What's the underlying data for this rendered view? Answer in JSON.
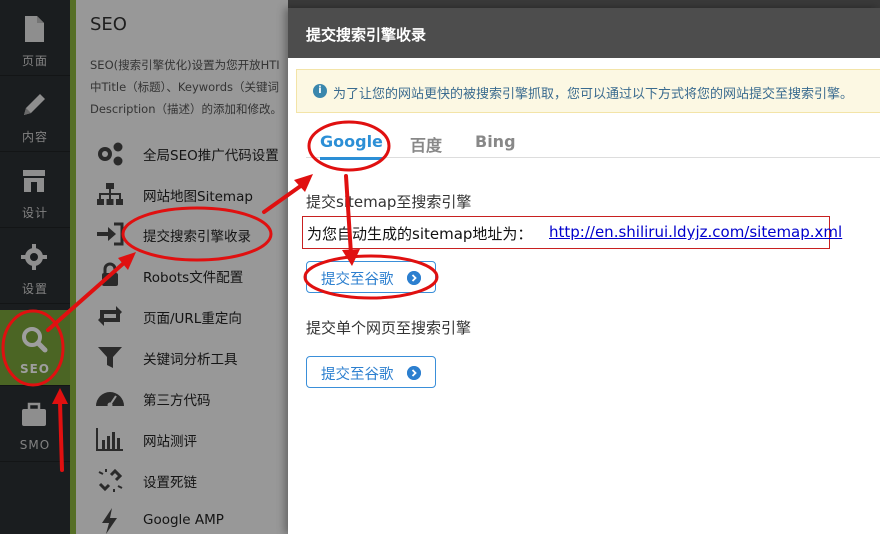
{
  "rail": {
    "items": [
      {
        "label": "页面",
        "icon": "page-icon"
      },
      {
        "label": "内容",
        "icon": "pencil-icon"
      },
      {
        "label": "设计",
        "icon": "store-icon"
      },
      {
        "label": "设置",
        "icon": "gear-icon"
      },
      {
        "label": "SEO",
        "icon": "search-icon"
      },
      {
        "label": "SMO",
        "icon": "briefcase-icon"
      }
    ]
  },
  "seo_panel": {
    "title": "SEO",
    "desc_lines": [
      "SEO(搜索引擎优化)设置为您开放HTI",
      "中Title（标题）、Keywords（关键词",
      "Description（描述）的添加和修改。"
    ],
    "menu": [
      {
        "label": "全局SEO推广代码设置",
        "icon": "gears-icon"
      },
      {
        "label": "网站地图Sitemap",
        "icon": "sitemap-icon"
      },
      {
        "label": "提交搜索引擎收录",
        "icon": "sign-in-icon"
      },
      {
        "label": "Robots文件配置",
        "icon": "lock-icon"
      },
      {
        "label": "页面/URL重定向",
        "icon": "retweet-icon"
      },
      {
        "label": "关键词分析工具",
        "icon": "filter-icon"
      },
      {
        "label": "第三方代码",
        "icon": "dashboard-icon"
      },
      {
        "label": "网站测评",
        "icon": "bar-chart-icon"
      },
      {
        "label": "设置死链",
        "icon": "unlink-icon"
      },
      {
        "label": "Google AMP",
        "icon": "bolt-icon"
      }
    ]
  },
  "modal": {
    "title": "提交搜索引擎收录",
    "tip": "为了让您的网站更快的被搜索引擎抓取，您可以通过以下方式将您的网站提交至搜索引擎。",
    "tabs": [
      "Google",
      "百度",
      "Bing"
    ],
    "active_tab": "Google",
    "section1_title": "提交sitemap至搜索引擎",
    "sitemap_label": "为您自动生成的sitemap地址为：",
    "sitemap_url": "http://en.shilirui.ldyjz.com/sitemap.xml",
    "submit_button": "提交至谷歌",
    "section2_title": "提交单个网页至搜索引擎",
    "submit_button2": "提交至谷歌"
  },
  "colors": {
    "rail_bg": "#2b2f33",
    "active_green": "#7aa33a",
    "primary_blue": "#2c8fd6",
    "annotation_red": "#e01010"
  }
}
